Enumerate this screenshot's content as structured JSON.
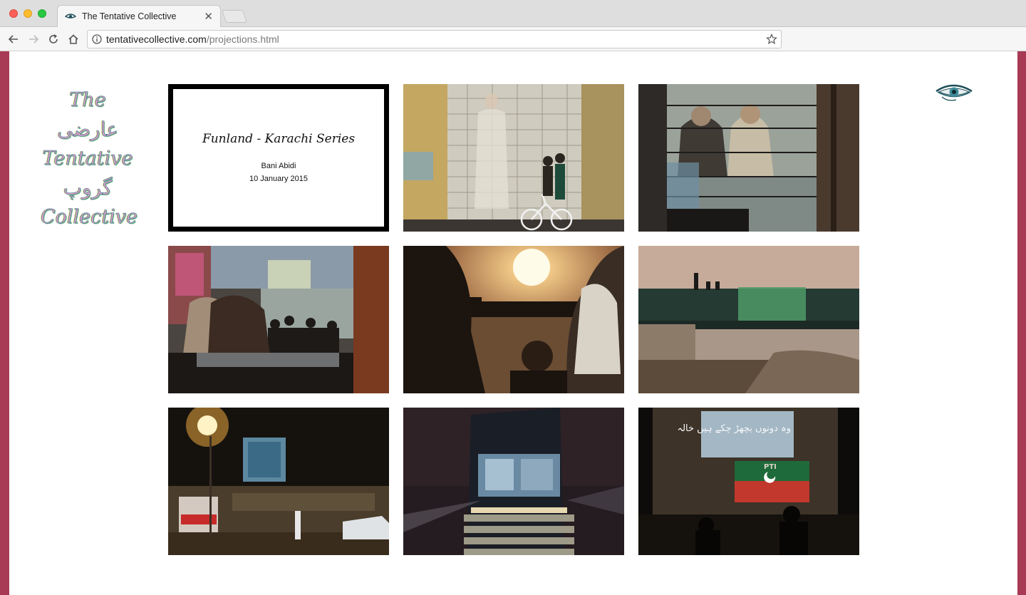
{
  "browser": {
    "tab_title": "The Tentative Collective",
    "url_host": "tentativecollective.com",
    "url_path": "/projections.html",
    "icons": [
      "back-arrow-icon",
      "forward-arrow-icon",
      "reload-icon",
      "home-icon",
      "info-icon",
      "star-icon",
      "close-icon"
    ]
  },
  "site": {
    "logo_lines": [
      "The",
      "عارضی",
      "Tentative",
      "گروپ",
      "Collective"
    ],
    "eye_icon": "eye-icon"
  },
  "gallery": {
    "title_card": {
      "title": "Funland - Karachi Series",
      "artist": "Bani Abidi",
      "date": "10 January 2015"
    },
    "photo_9_overlay_text": "وہ دونوں بچھڑ چکے ہیں خالہ",
    "photo_9_sign": "PTI"
  },
  "colors": {
    "frame": "#a93a55",
    "page_bg": "#ffffff",
    "chrome_bg": "#dedede"
  }
}
